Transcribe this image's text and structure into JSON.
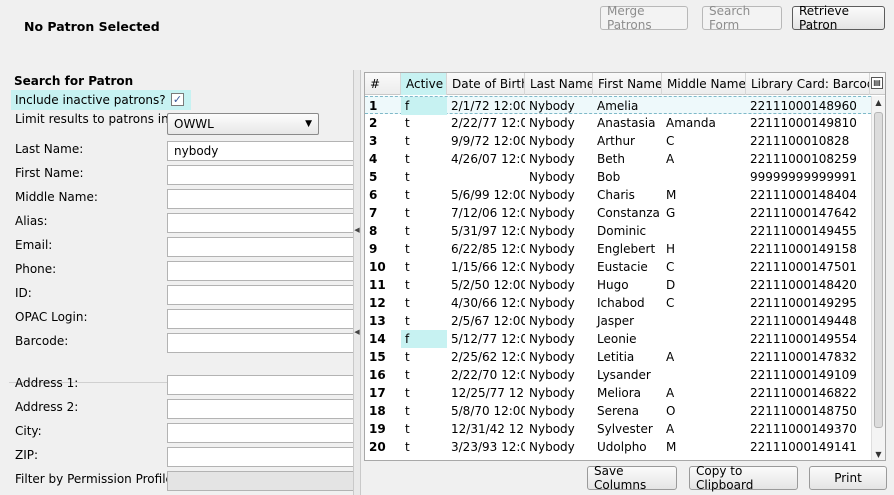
{
  "header": {
    "title": "No Patron Selected",
    "merge_label": "Merge Patrons",
    "search_form_label": "Search Form",
    "retrieve_label": "Retrieve Patron"
  },
  "search": {
    "section_title": "Search for Patron",
    "include_inactive_label": "Include inactive patrons?",
    "include_inactive_checked": true,
    "limit_label": "Limit results to patrons in",
    "limit_value": "OWWL",
    "fields": {
      "last_name": {
        "label": "Last Name:",
        "value": "nybody"
      },
      "first_name": {
        "label": "First Name:",
        "value": ""
      },
      "middle_name": {
        "label": "Middle Name:",
        "value": ""
      },
      "alias": {
        "label": "Alias:",
        "value": ""
      },
      "email": {
        "label": "Email:",
        "value": ""
      },
      "phone": {
        "label": "Phone:",
        "value": ""
      },
      "id": {
        "label": "ID:",
        "value": ""
      },
      "opac_login": {
        "label": "OPAC Login:",
        "value": ""
      },
      "barcode": {
        "label": "Barcode:",
        "value": ""
      },
      "address1": {
        "label": "Address 1:",
        "value": ""
      },
      "address2": {
        "label": "Address 2:",
        "value": ""
      },
      "city": {
        "label": "City:",
        "value": ""
      },
      "zip": {
        "label": "ZIP:",
        "value": ""
      },
      "perm_profile": {
        "label": "Filter by Permission Profile:",
        "value": ""
      }
    }
  },
  "grid": {
    "columns": [
      "#",
      "Active",
      "Date of Birth",
      "Last Name",
      "First Name",
      "Middle Name",
      "Library Card: Barcode"
    ],
    "rows": [
      [
        "1",
        "f",
        "2/1/72 12:00...",
        "Nybody",
        "Amelia",
        "",
        "22111000148960"
      ],
      [
        "2",
        "t",
        "2/22/77 12:0...",
        "Nybody",
        "Anastasia",
        "Amanda",
        "22111000149810"
      ],
      [
        "3",
        "t",
        "9/9/72 12:00...",
        "Nybody",
        "Arthur",
        "C",
        "2211100010828"
      ],
      [
        "4",
        "t",
        "4/26/07 12:0...",
        "Nybody",
        "Beth",
        "A",
        "22111000108259"
      ],
      [
        "5",
        "t",
        "",
        "Nybody",
        "Bob",
        "",
        "99999999999991"
      ],
      [
        "6",
        "t",
        "5/6/99 12:00...",
        "Nybody",
        "Charis",
        "M",
        "22111000148404"
      ],
      [
        "7",
        "t",
        "7/12/06 12:0...",
        "Nybody",
        "Constanza",
        "G",
        "22111000147642"
      ],
      [
        "8",
        "t",
        "5/31/97 12:0...",
        "Nybody",
        "Dominic",
        "",
        "22111000149455"
      ],
      [
        "9",
        "t",
        "6/22/85 12:0...",
        "Nybody",
        "Englebert",
        "H",
        "22111000149158"
      ],
      [
        "10",
        "t",
        "1/15/66 12:0...",
        "Nybody",
        "Eustacie",
        "C",
        "22111000147501"
      ],
      [
        "11",
        "t",
        "5/2/50 12:00...",
        "Nybody",
        "Hugo",
        "D",
        "22111000148420"
      ],
      [
        "12",
        "t",
        "4/30/66 12:0...",
        "Nybody",
        "Ichabod",
        "C",
        "22111000149295"
      ],
      [
        "13",
        "t",
        "2/5/67 12:00...",
        "Nybody",
        "Jasper",
        "",
        "22111000149448"
      ],
      [
        "14",
        "f",
        "5/12/77 12:0...",
        "Nybody",
        "Leonie",
        "",
        "22111000149554"
      ],
      [
        "15",
        "t",
        "2/25/62 12:0...",
        "Nybody",
        "Letitia",
        "A",
        "22111000147832"
      ],
      [
        "16",
        "t",
        "2/22/70 12:0...",
        "Nybody",
        "Lysander",
        "",
        "22111000149109"
      ],
      [
        "17",
        "t",
        "12/25/77 12:...",
        "Nybody",
        "Meliora",
        "A",
        "22111000146822"
      ],
      [
        "18",
        "t",
        "5/8/70 12:00...",
        "Nybody",
        "Serena",
        "O",
        "22111000148750"
      ],
      [
        "19",
        "t",
        "12/31/42 12:...",
        "Nybody",
        "Sylvester",
        "A",
        "22111000149370"
      ],
      [
        "20",
        "t",
        "3/23/93 12:0...",
        "Nybody",
        "Udolpho",
        "M",
        "22111000149141"
      ]
    ],
    "selected_row": 0
  },
  "footer": {
    "save_columns_label": "Save Columns",
    "copy_label": "Copy to Clipboard",
    "print_label": "Print"
  },
  "colors": {
    "highlight": "#c7f2f2",
    "background": "#f0f0f0"
  }
}
